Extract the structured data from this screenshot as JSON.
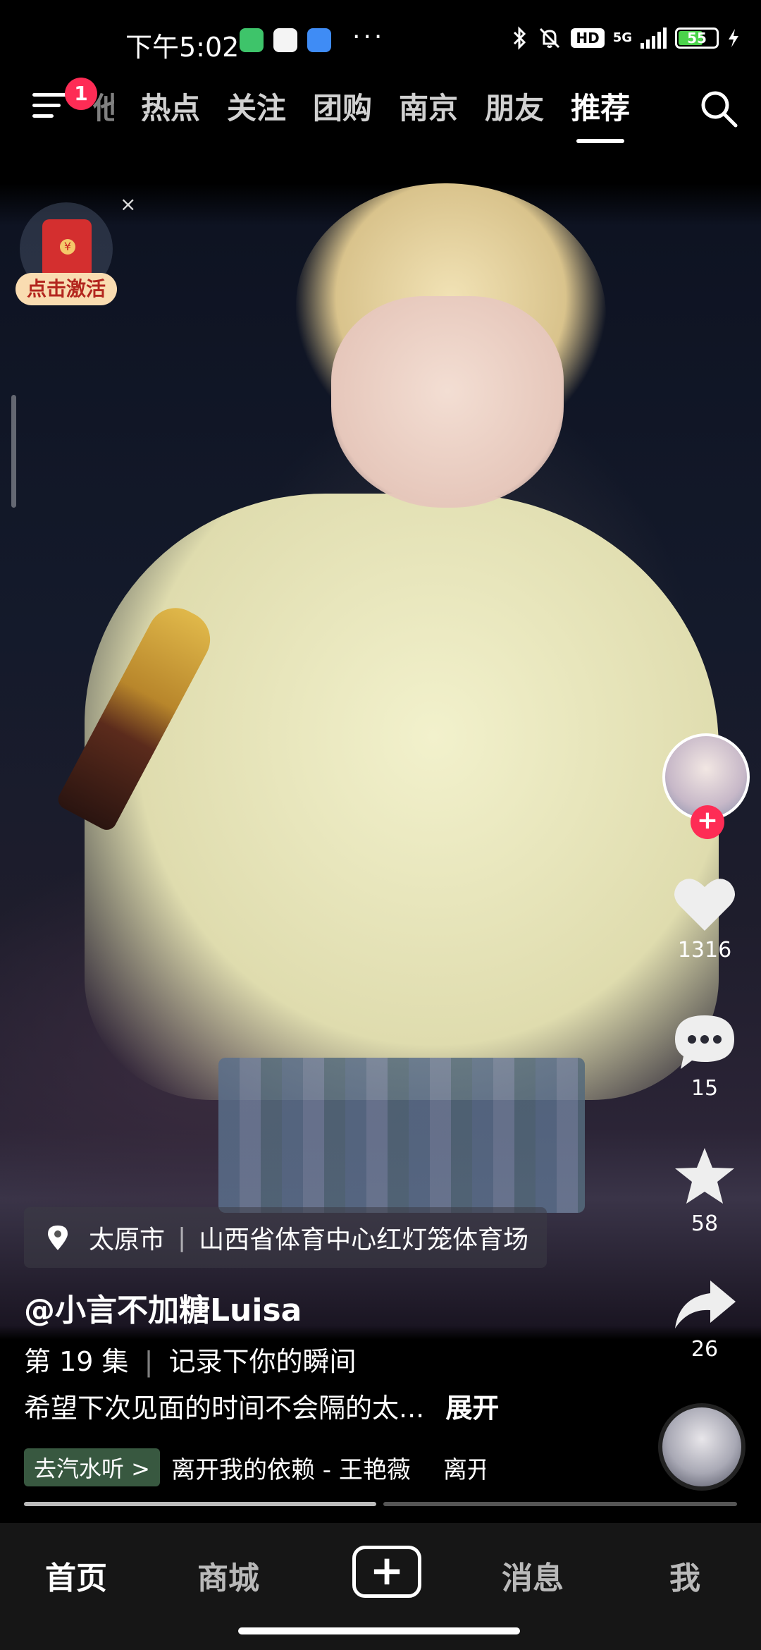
{
  "status_bar": {
    "time": "下午5:02",
    "dots": "···",
    "hd": "HD",
    "network": "5G",
    "battery": "55"
  },
  "top_nav": {
    "notification_count": "1",
    "tabs": [
      "他",
      "热点",
      "关注",
      "团购",
      "南京",
      "朋友",
      "推荐"
    ],
    "active_tab": "推荐"
  },
  "promo": {
    "cta": "点击激活",
    "close": "×"
  },
  "rail": {
    "follow": "+",
    "likes": "1316",
    "comments": "15",
    "favorites": "58",
    "shares": "26"
  },
  "info": {
    "location_city": "太原市",
    "location_sep": "|",
    "location_place": "山西省体育中心红灯笼体育场",
    "author": "@小言不加糖Luisa",
    "series_label": "第 19 集",
    "series_sep": "|",
    "series_title": "记录下你的瞬间",
    "description": "希望下次见面的时间不会隔的太...",
    "expand": "展开",
    "music_pill": "去汽水听 >",
    "song": "离开我的依赖 - 王艳薇",
    "song_next": "离开"
  },
  "bottom_nav": {
    "home": "首页",
    "mall": "商城",
    "create": "+",
    "messages": "消息",
    "me": "我"
  }
}
